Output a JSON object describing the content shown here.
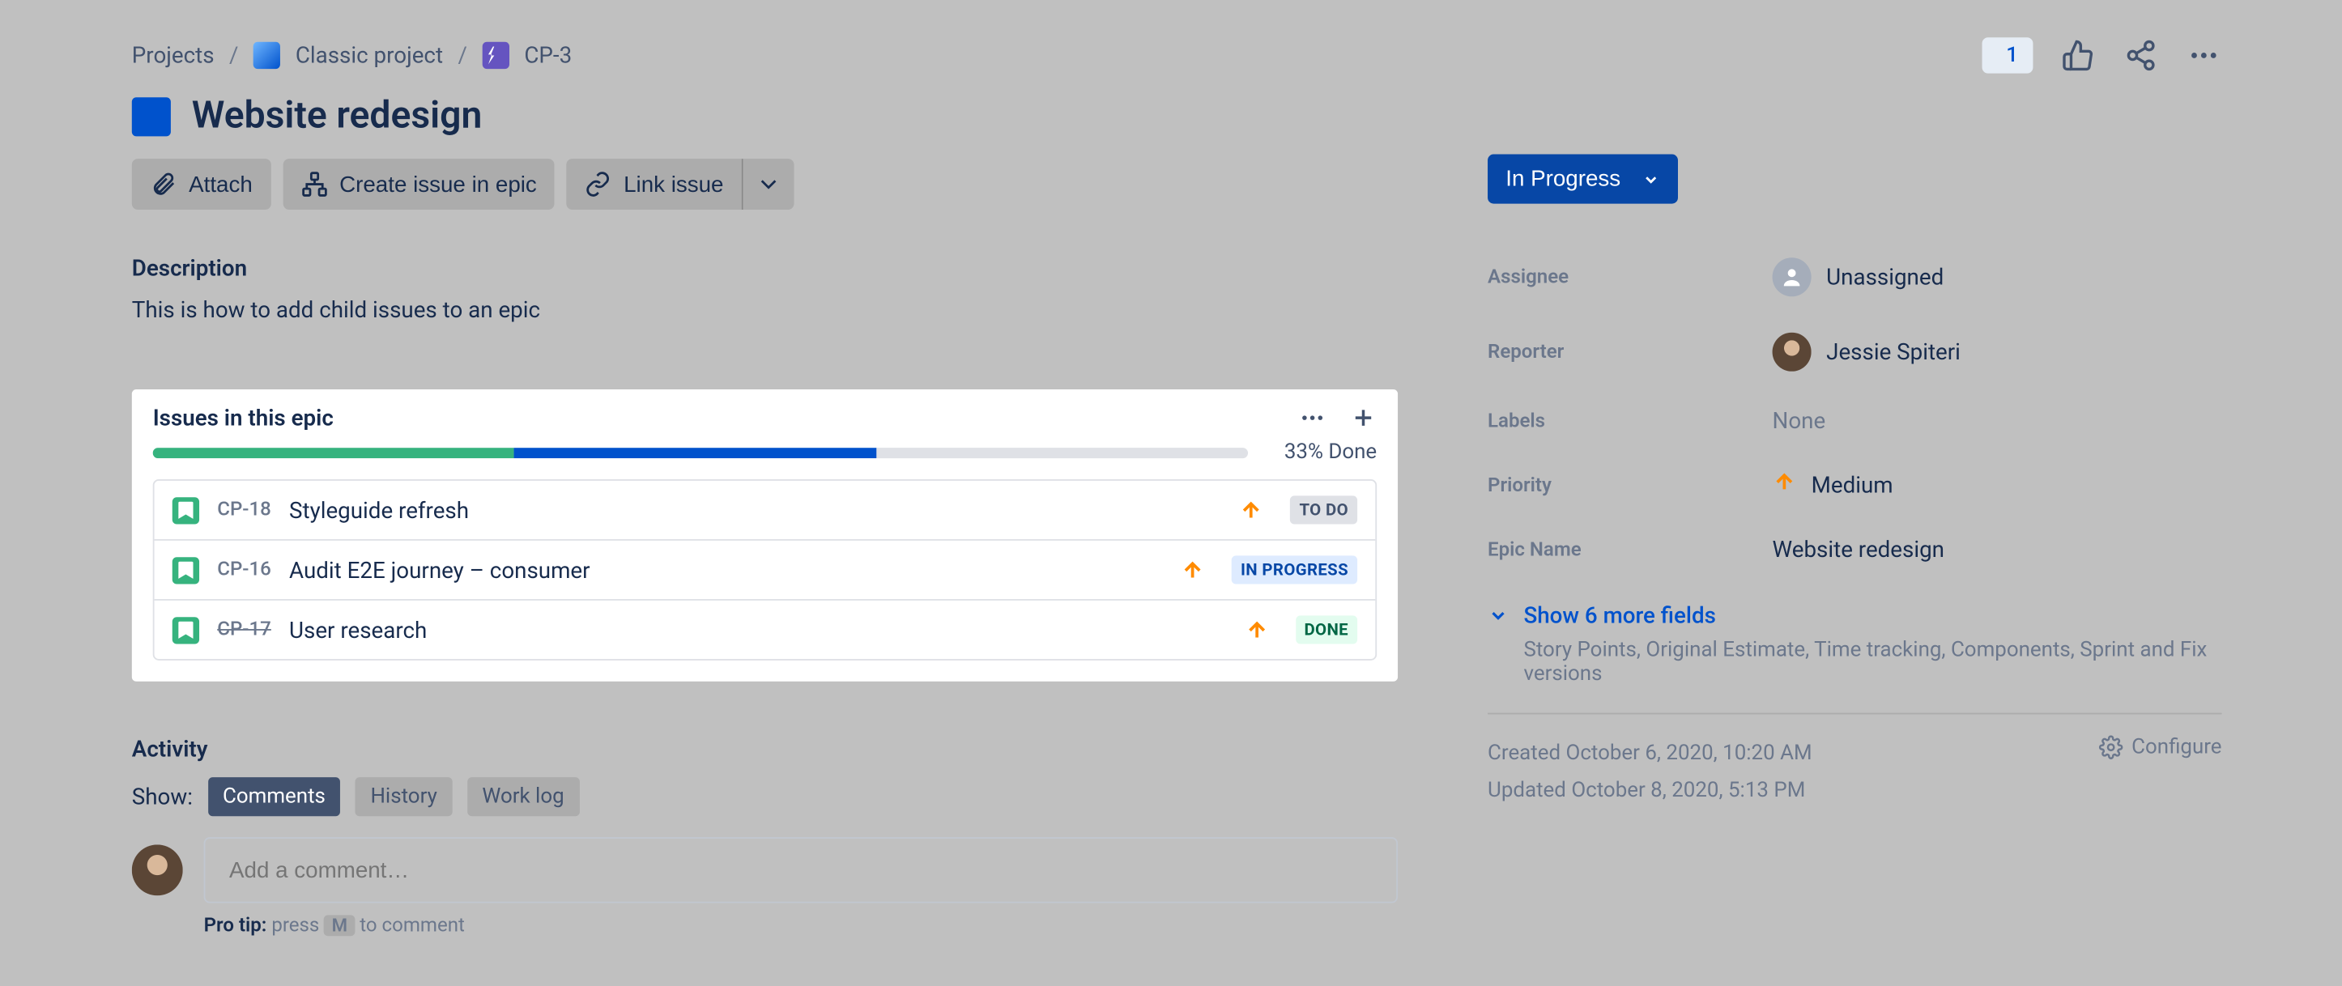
{
  "breadcrumbs": {
    "root": "Projects",
    "project": "Classic project",
    "issue": "CP-3"
  },
  "header_icons": {
    "watch_count": "1"
  },
  "title": "Website redesign",
  "toolbar": {
    "attach": "Attach",
    "create_in_epic": "Create issue in epic",
    "link_issue": "Link issue"
  },
  "description": {
    "heading": "Description",
    "body": "This is how to add child issues to an epic"
  },
  "epic_panel": {
    "heading": "Issues in this epic",
    "percent_done_label": "33% Done",
    "progress": {
      "done_pct": 33,
      "inprogress_pct": 33
    },
    "issues": [
      {
        "key": "CP-18",
        "summary": "Styleguide refresh",
        "status": "TO DO",
        "status_class": "status-todo",
        "completed": false
      },
      {
        "key": "CP-16",
        "summary": "Audit E2E journey – consumer",
        "status": "IN PROGRESS",
        "status_class": "status-inprogress",
        "completed": false
      },
      {
        "key": "CP-17",
        "summary": "User research",
        "status": "DONE",
        "status_class": "status-done",
        "completed": true
      }
    ]
  },
  "activity": {
    "heading": "Activity",
    "show_label": "Show:",
    "tabs": {
      "comments": "Comments",
      "history": "History",
      "worklog": "Work log"
    },
    "comment_placeholder": "Add a comment…",
    "protip_lead": "Pro tip:",
    "protip_press": " press ",
    "protip_key": "M",
    "protip_tail": " to comment"
  },
  "status_button": "In Progress",
  "details": {
    "assignee_label": "Assignee",
    "assignee_value": "Unassigned",
    "reporter_label": "Reporter",
    "reporter_value": "Jessie Spiteri",
    "labels_label": "Labels",
    "labels_value": "None",
    "priority_label": "Priority",
    "priority_value": "Medium",
    "epicname_label": "Epic Name",
    "epicname_value": "Website redesign"
  },
  "show_more": {
    "label": "Show 6 more fields",
    "sub": "Story Points, Original Estimate, Time tracking, Components, Sprint and Fix versions"
  },
  "meta": {
    "created": "Created October 6, 2020, 10:20 AM",
    "updated": "Updated October 8, 2020, 5:13 PM",
    "configure": "Configure"
  }
}
